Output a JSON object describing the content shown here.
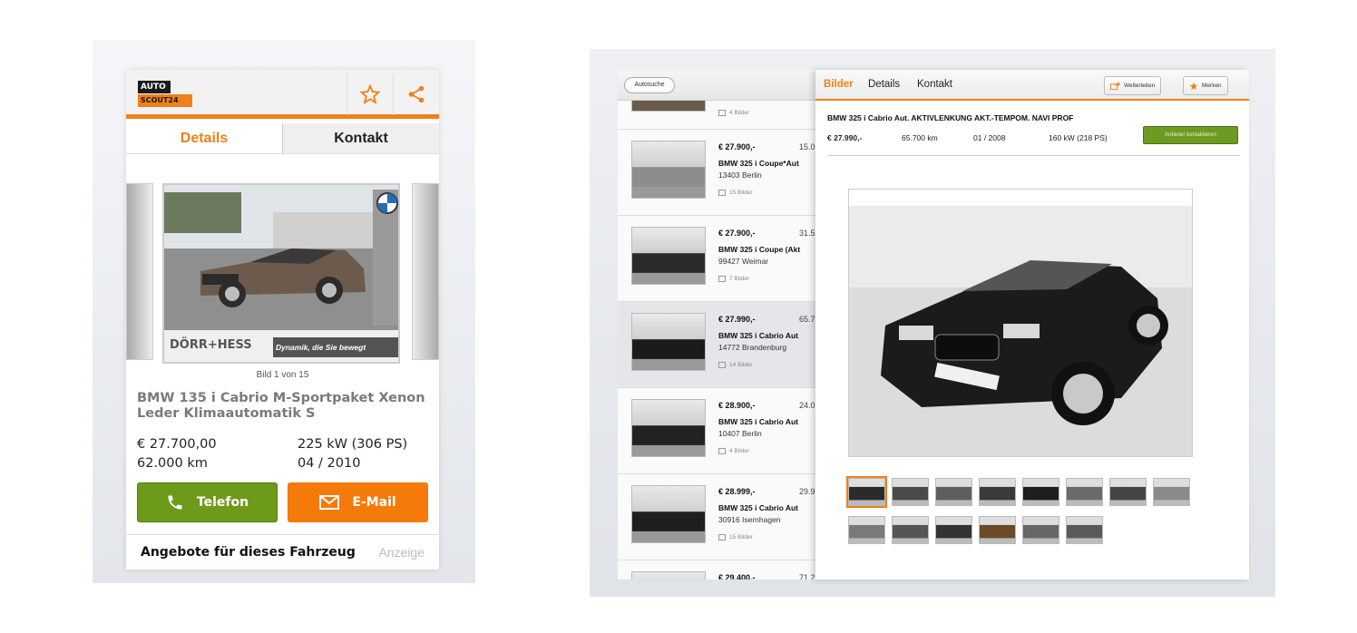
{
  "colors": {
    "accent": "#f08019",
    "green": "#6e9a19",
    "orange_button": "#f47a0a"
  },
  "phone": {
    "logo": {
      "line1": "AUTO",
      "line2": "SCOUT24"
    },
    "icons": {
      "favorite": "star-icon",
      "share": "share-icon"
    },
    "tabs": [
      {
        "label": "Details",
        "active": true
      },
      {
        "label": "Kontakt",
        "active": false
      }
    ],
    "gallery": {
      "caption": "Bild 1 von 15",
      "dealer_logo": "DÖRR+HESS",
      "dealer_slogan": "Dynamik, die Sie bewegt"
    },
    "title": "BMW 135 i Cabrio M-Sportpaket Xenon Leder Klimaautomatik S",
    "price": "€ 27.700,00",
    "power": "225 kW (306 PS)",
    "mileage": "62.000 km",
    "registration": "04 / 2010",
    "buttons": {
      "phone": "Telefon",
      "email": "E-Mail"
    },
    "offers": {
      "label": "Angebote für dieses Fahrzeug",
      "ad": "Anzeige"
    }
  },
  "tablet": {
    "back_button": "Autosuche",
    "first_item_pics": "4 Bilder",
    "list": [
      {
        "price": "€ 27.900,-",
        "km": "15.0",
        "title": "BMW 325 i Coupe*Aut",
        "city": "13403 Berlin",
        "pics": "15 Bilder",
        "selected": false,
        "car_color": "#8c8c8c"
      },
      {
        "price": "€ 27.900,-",
        "km": "31.5",
        "title": "BMW 325 i Coupe (Akt",
        "city": "99427 Weimar",
        "pics": "7 Bilder",
        "selected": false,
        "car_color": "#2a2a2a"
      },
      {
        "price": "€ 27.990,-",
        "km": "65.7",
        "title": "BMW 325 i Cabrio Aut",
        "city": "14772 Brandenburg",
        "pics": "14 Bilder",
        "selected": true,
        "car_color": "#1b1b1b"
      },
      {
        "price": "€ 28.900,-",
        "km": "24.0",
        "title": "BMW 325 i Cabrio Aut",
        "city": "10407 Berlin",
        "pics": "4 Bilder",
        "selected": false,
        "car_color": "#222222"
      },
      {
        "price": "€ 28.999,-",
        "km": "29.9",
        "title": "BMW 325 i Cabrio Aut",
        "city": "30916 Isernhagen",
        "pics": "15 Bilder",
        "selected": false,
        "car_color": "#1f1f1f"
      },
      {
        "price": "€ 29.400,-",
        "km": "71.2",
        "title": "",
        "city": "",
        "pics": "",
        "selected": false,
        "car_color": "#bdbdbd"
      }
    ],
    "detail": {
      "tabs": [
        {
          "label": "Bilder",
          "active": true
        },
        {
          "label": "Details",
          "active": false
        },
        {
          "label": "Kontakt",
          "active": false
        }
      ],
      "share_button": "Weiterleiten",
      "save_button": "Merken",
      "title": "BMW 325 i Cabrio Aut. AKTIVLENKUNG AKT.-TEMPOM. NAVI PROF",
      "price": "€ 27.990,-",
      "mileage": "65.700 km",
      "registration": "01 / 2008",
      "power": "160 kW (218 PS)",
      "contact_button": "Anbieter kontaktieren",
      "thumbnails_row1": 8,
      "thumbnails_row2": 6
    }
  }
}
